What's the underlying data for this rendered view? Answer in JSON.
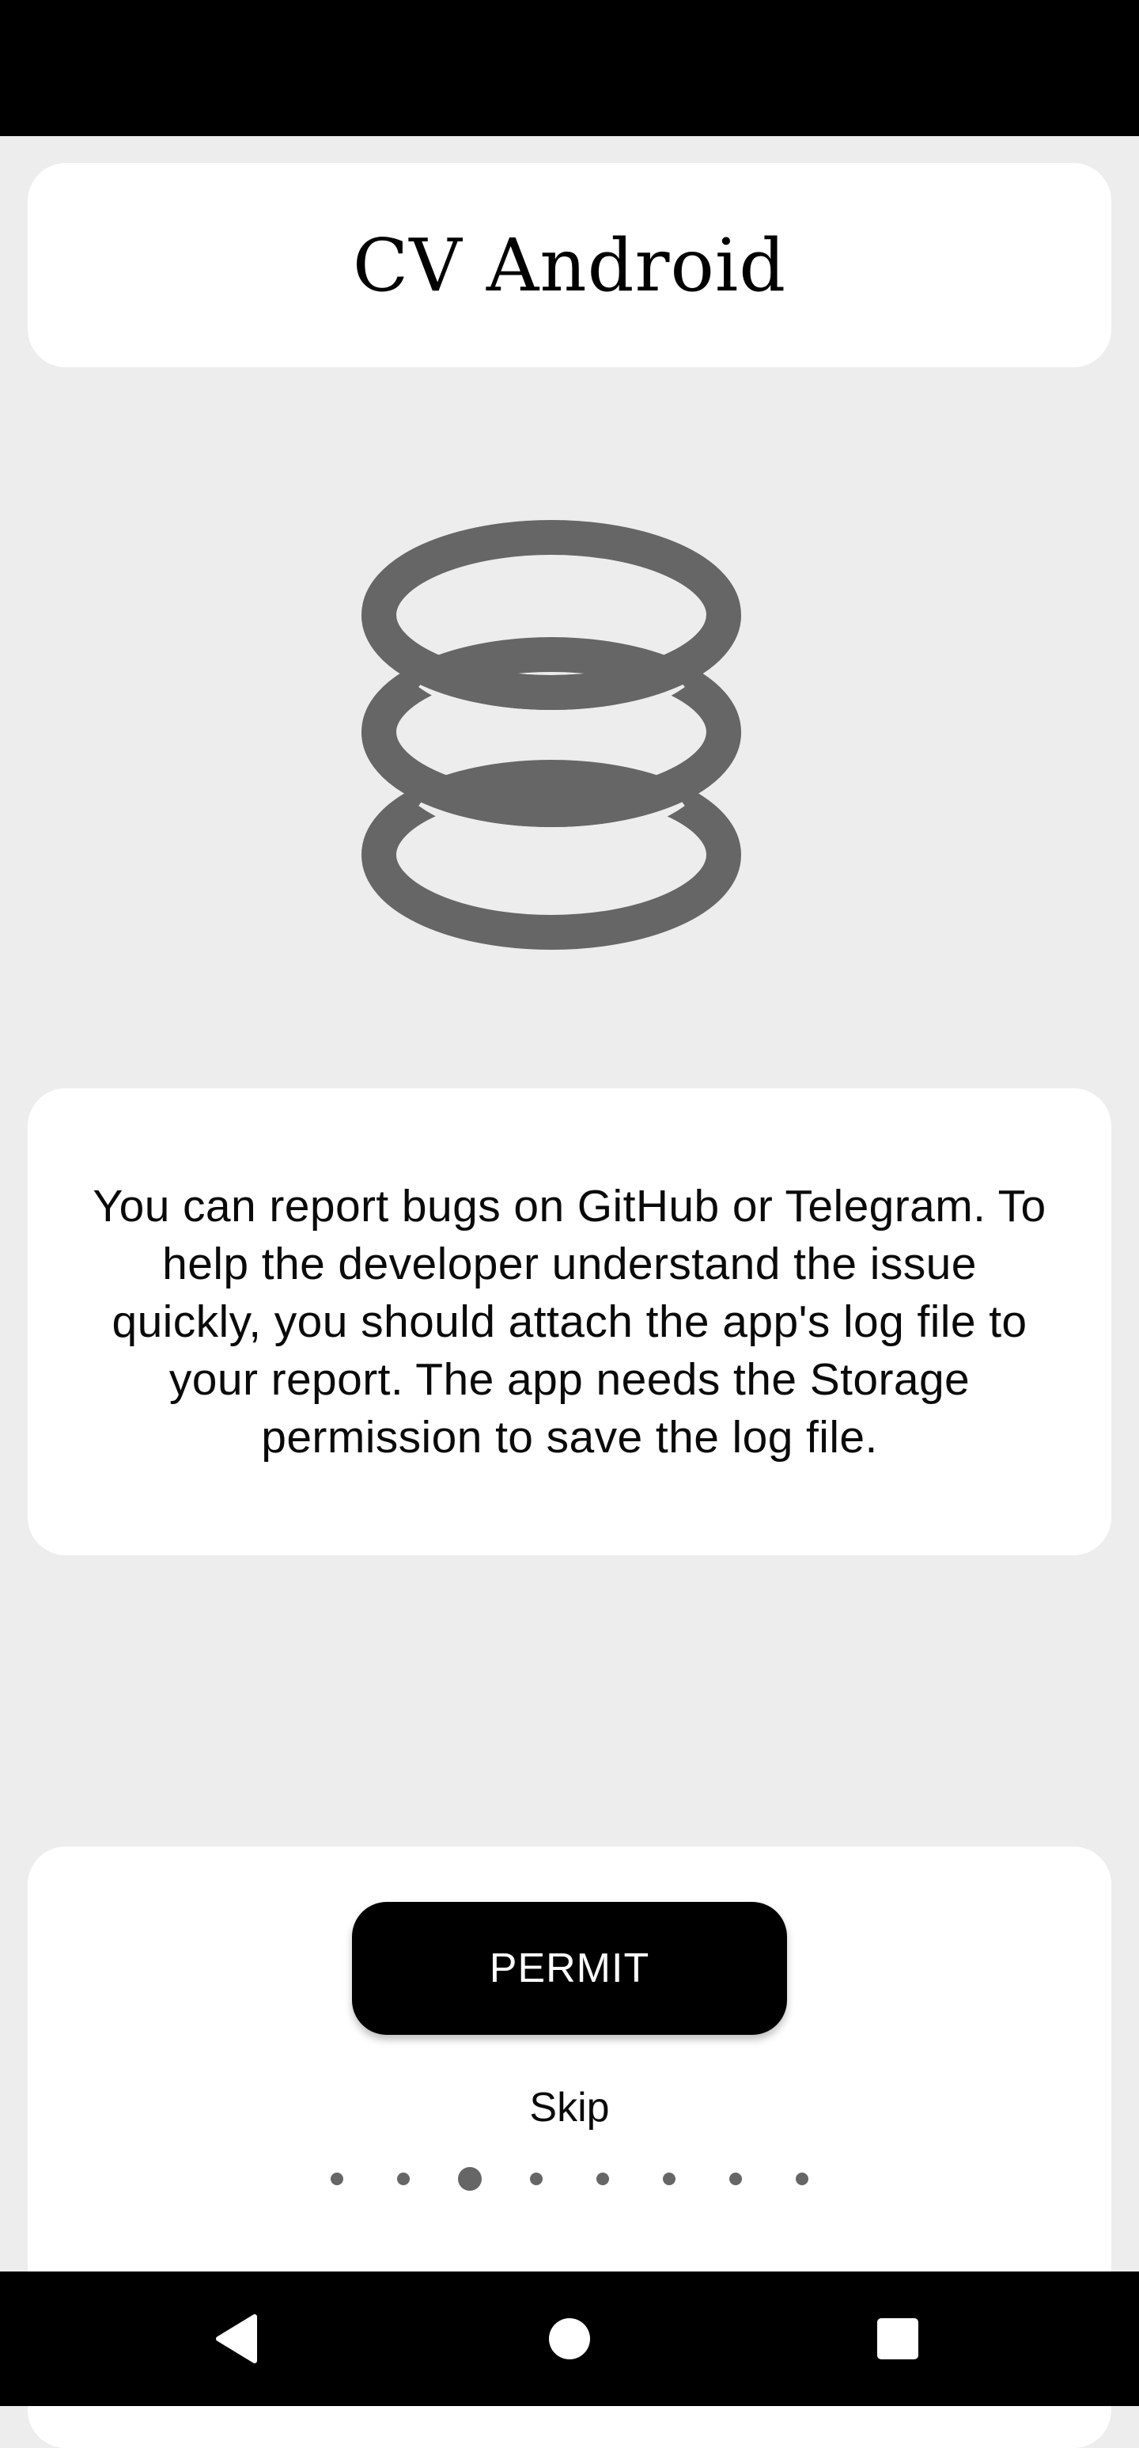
{
  "app": {
    "title": "CV Android"
  },
  "illustration": {
    "icon": "database-stack-icon",
    "color": "#666666"
  },
  "description": {
    "text": "You can report bugs on GitHub or Telegram. To help the developer understand the issue quickly, you should attach the app's log file to your report. The app needs the Storage permission to save the log file."
  },
  "actions": {
    "permit_label": "PERMIT",
    "skip_label": "Skip"
  },
  "pager": {
    "total": 8,
    "current": 3
  },
  "navigation": {
    "back_icon": "back-triangle-icon",
    "home_icon": "home-circle-icon",
    "recents_icon": "recents-square-icon"
  },
  "colors": {
    "background": "#ededed",
    "card": "#ffffff",
    "button": "#000000",
    "icon": "#666666"
  }
}
